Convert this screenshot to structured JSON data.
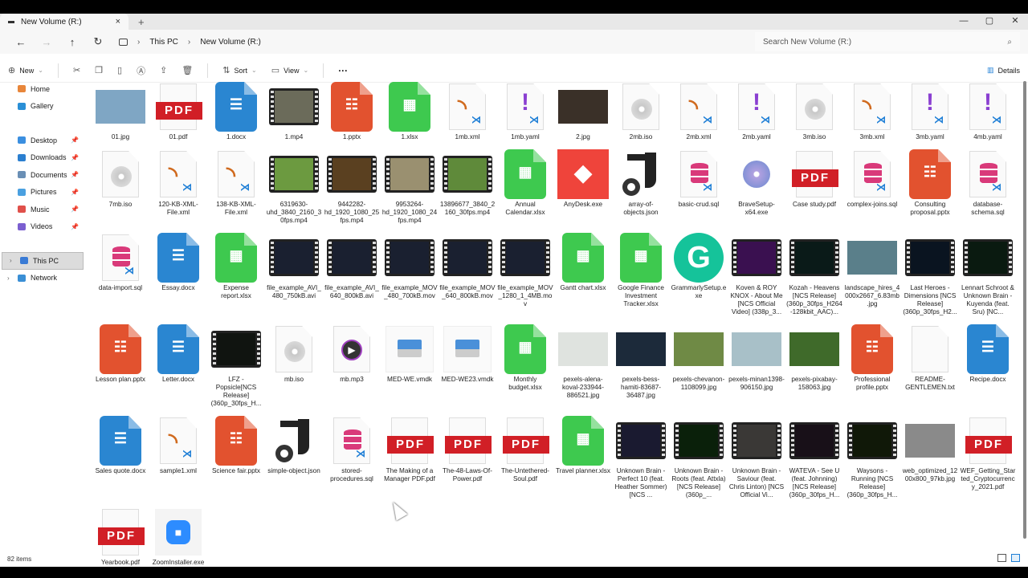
{
  "window": {
    "tab_title": "New Volume (R:)",
    "close": "×",
    "new_tab": "+"
  },
  "window_controls": [
    "—",
    "▢",
    "✕"
  ],
  "address": {
    "crumbs": [
      "This PC",
      "New Volume (R:)"
    ],
    "search_placeholder": "Search New Volume (R:)"
  },
  "toolbar": {
    "new": "New",
    "sort": "Sort",
    "view": "View",
    "more": "···",
    "details": "Details"
  },
  "sidebar": {
    "items": [
      {
        "label": "Home",
        "color": "#e8863a"
      },
      {
        "label": "Gallery",
        "color": "#2a8fd6"
      },
      {
        "label": "Desktop",
        "color": "#3b8fe0",
        "pinned": true
      },
      {
        "label": "Downloads",
        "color": "#2b7fd0",
        "pinned": true
      },
      {
        "label": "Documents",
        "color": "#6a8fb5",
        "pinned": true
      },
      {
        "label": "Pictures",
        "color": "#4aa0e0",
        "pinned": true
      },
      {
        "label": "Music",
        "color": "#e0504a",
        "pinned": true
      },
      {
        "label": "Videos",
        "color": "#7b5fd0",
        "pinned": true
      },
      {
        "label": "This PC",
        "color": "#3a7bd5",
        "selected": true
      },
      {
        "label": "Network",
        "color": "#3a8fd5"
      }
    ]
  },
  "status": {
    "items_count": "82 items"
  },
  "files": [
    {
      "n": "01.jpg",
      "t": "img",
      "c": "#7fa6c4"
    },
    {
      "n": "01.pdf",
      "t": "pdf"
    },
    {
      "n": "1.docx",
      "t": "docx"
    },
    {
      "n": "1.mp4",
      "t": "video",
      "c": "#6b6b5a"
    },
    {
      "n": "1.pptx",
      "t": "pptx"
    },
    {
      "n": "1.xlsx",
      "t": "xlsx"
    },
    {
      "n": "1mb.xml",
      "t": "xml"
    },
    {
      "n": "1mb.yaml",
      "t": "yaml"
    },
    {
      "n": "2.jpg",
      "t": "img",
      "c": "#3a3028"
    },
    {
      "n": "2mb.iso",
      "t": "iso"
    },
    {
      "n": "2mb.xml",
      "t": "xml"
    },
    {
      "n": "2mb.yaml",
      "t": "yaml"
    },
    {
      "n": "3mb.iso",
      "t": "iso"
    },
    {
      "n": "3mb.xml",
      "t": "xml"
    },
    {
      "n": "3mb.yaml",
      "t": "yaml"
    },
    {
      "n": "4mb.yaml",
      "t": "yaml"
    },
    {
      "n": "7mb.iso",
      "t": "iso"
    },
    {
      "n": "120-KB-XML-File.xml",
      "t": "xml"
    },
    {
      "n": "138-KB-XML-File.xml",
      "t": "xml"
    },
    {
      "n": "6319630-uhd_3840_2160_30fps.mp4",
      "t": "video",
      "c": "#6c9a40"
    },
    {
      "n": "9442282-hd_1920_1080_25fps.mp4",
      "t": "video",
      "c": "#5a4020"
    },
    {
      "n": "9953264-hd_1920_1080_24fps.mp4",
      "t": "video",
      "c": "#9a9070"
    },
    {
      "n": "13896677_3840_2160_30fps.mp4",
      "t": "video",
      "c": "#5f8a3a"
    },
    {
      "n": "Annual Calendar.xlsx",
      "t": "xlsx"
    },
    {
      "n": "AnyDesk.exe",
      "t": "anydesk"
    },
    {
      "n": "array-of-objects.json",
      "t": "json"
    },
    {
      "n": "basic-crud.sql",
      "t": "sql"
    },
    {
      "n": "BraveSetup-x64.exe",
      "t": "brave"
    },
    {
      "n": "Case study.pdf",
      "t": "pdf"
    },
    {
      "n": "complex-joins.sql",
      "t": "sql"
    },
    {
      "n": "Consulting proposal.pptx",
      "t": "pptx"
    },
    {
      "n": "database-schema.sql",
      "t": "sql"
    },
    {
      "n": "data-import.sql",
      "t": "sql"
    },
    {
      "n": "Essay.docx",
      "t": "docx"
    },
    {
      "n": "Expense report.xlsx",
      "t": "xlsx"
    },
    {
      "n": "file_example_AVI_480_750kB.avi",
      "t": "video",
      "c": "#1a2030"
    },
    {
      "n": "file_example_AVI_640_800kB.avi",
      "t": "video",
      "c": "#1a2030"
    },
    {
      "n": "file_example_MOV_480_700kB.mov",
      "t": "video",
      "c": "#1a2030"
    },
    {
      "n": "file_example_MOV_640_800kB.mov",
      "t": "video",
      "c": "#1a2030"
    },
    {
      "n": "file_example_MOV_1280_1_4MB.mov",
      "t": "video",
      "c": "#1a2030"
    },
    {
      "n": "Gantt chart.xlsx",
      "t": "xlsx"
    },
    {
      "n": "Google Finance Investment Tracker.xlsx",
      "t": "xlsx"
    },
    {
      "n": "GrammarlySetup.exe",
      "t": "grammarly"
    },
    {
      "n": "Koven & ROY KNOX - About Me [NCS Official Video] (338p_3...",
      "t": "video",
      "c": "#3a1050"
    },
    {
      "n": "Kozah - Heavens [NCS Release] (360p_30fps_H264-128kbit_AAC)...",
      "t": "video",
      "c": "#0a1a18"
    },
    {
      "n": "landscape_hires_4000x2667_6.83mb.jpg",
      "t": "img",
      "c": "#5a7f8a"
    },
    {
      "n": "Last Heroes - Dimensions [NCS Release] (360p_30fps_H2...",
      "t": "video",
      "c": "#0a1420"
    },
    {
      "n": "Lennart Schroot & Unknown Brain - Kuyenda (feat. Sru) [NC...",
      "t": "video",
      "c": "#0a1a10"
    },
    {
      "n": "Lesson plan.pptx",
      "t": "pptx"
    },
    {
      "n": "Letter.docx",
      "t": "docx"
    },
    {
      "n": "LFZ - Popsicle[NCS Release] (360p_30fps_H...",
      "t": "video",
      "c": "#101410"
    },
    {
      "n": "mb.iso",
      "t": "iso"
    },
    {
      "n": "mb.mp3",
      "t": "mp3"
    },
    {
      "n": "MED-WE.vmdk",
      "t": "vmdk"
    },
    {
      "n": "MED-WE23.vmdk",
      "t": "vmdk"
    },
    {
      "n": "Monthly budget.xlsx",
      "t": "xlsx"
    },
    {
      "n": "pexels-alena-koval-233944-886521.jpg",
      "t": "img",
      "c": "#dfe3df"
    },
    {
      "n": "pexels-bess-hamiti-83687-36487.jpg",
      "t": "img",
      "c": "#1c2a3a"
    },
    {
      "n": "pexels-chevanon-1108099.jpg",
      "t": "img",
      "c": "#6f8a45"
    },
    {
      "n": "pexels-minan1398-906150.jpg",
      "t": "img",
      "c": "#a8c0c8"
    },
    {
      "n": "pexels-pixabay-158063.jpg",
      "t": "img",
      "c": "#3f6a2a"
    },
    {
      "n": "Professional profile.pptx",
      "t": "pptx"
    },
    {
      "n": "README-GENTLEMEN.txt",
      "t": "txt"
    },
    {
      "n": "Recipe.docx",
      "t": "docx"
    },
    {
      "n": "Sales quote.docx",
      "t": "docx"
    },
    {
      "n": "sample1.xml",
      "t": "xml"
    },
    {
      "n": "Science fair.pptx",
      "t": "pptx"
    },
    {
      "n": "simple-object.json",
      "t": "json"
    },
    {
      "n": "stored-procedures.sql",
      "t": "sql"
    },
    {
      "n": "The Making of a Manager PDF.pdf",
      "t": "pdf"
    },
    {
      "n": "The-48-Laws-Of-Power.pdf",
      "t": "pdf"
    },
    {
      "n": "The-Untethered-Soul.pdf",
      "t": "pdf"
    },
    {
      "n": "Travel planner.xlsx",
      "t": "xlsx"
    },
    {
      "n": "Unknown Brain - Perfect 10 (feat. Heather Sommer) [NCS ...",
      "t": "video",
      "c": "#1a1a30"
    },
    {
      "n": "Unknown Brain - Roots (feat. Attxla) [NCS Release] (360p_...",
      "t": "video",
      "c": "#0a200a"
    },
    {
      "n": "Unknown Brain - Saviour (feat. Chris Linton) [NCS Official Vi...",
      "t": "video",
      "c": "#3a3836"
    },
    {
      "n": "WATEVA - See U (feat. Johnning) [NCS Release] (360p_30fps_H...",
      "t": "video",
      "c": "#181018"
    },
    {
      "n": "Waysons - Running [NCS Release] (360p_30fps_H...",
      "t": "video",
      "c": "#101808"
    },
    {
      "n": "web_optimized_1200x800_97kb.jpg",
      "t": "img",
      "c": "#8a8a8a"
    },
    {
      "n": "WEF_Getting_Started_Cryptocurrency_2021.pdf",
      "t": "pdf"
    },
    {
      "n": "Yearbook.pdf",
      "t": "pdf"
    },
    {
      "n": "ZoomInstaller.exe",
      "t": "zoom"
    }
  ],
  "colors": {
    "docx": "#2a86d1",
    "xlsx": "#3ec94f",
    "pptx": "#e2522f",
    "pdf": "#d11f26",
    "accent": "#1f7fd6"
  }
}
